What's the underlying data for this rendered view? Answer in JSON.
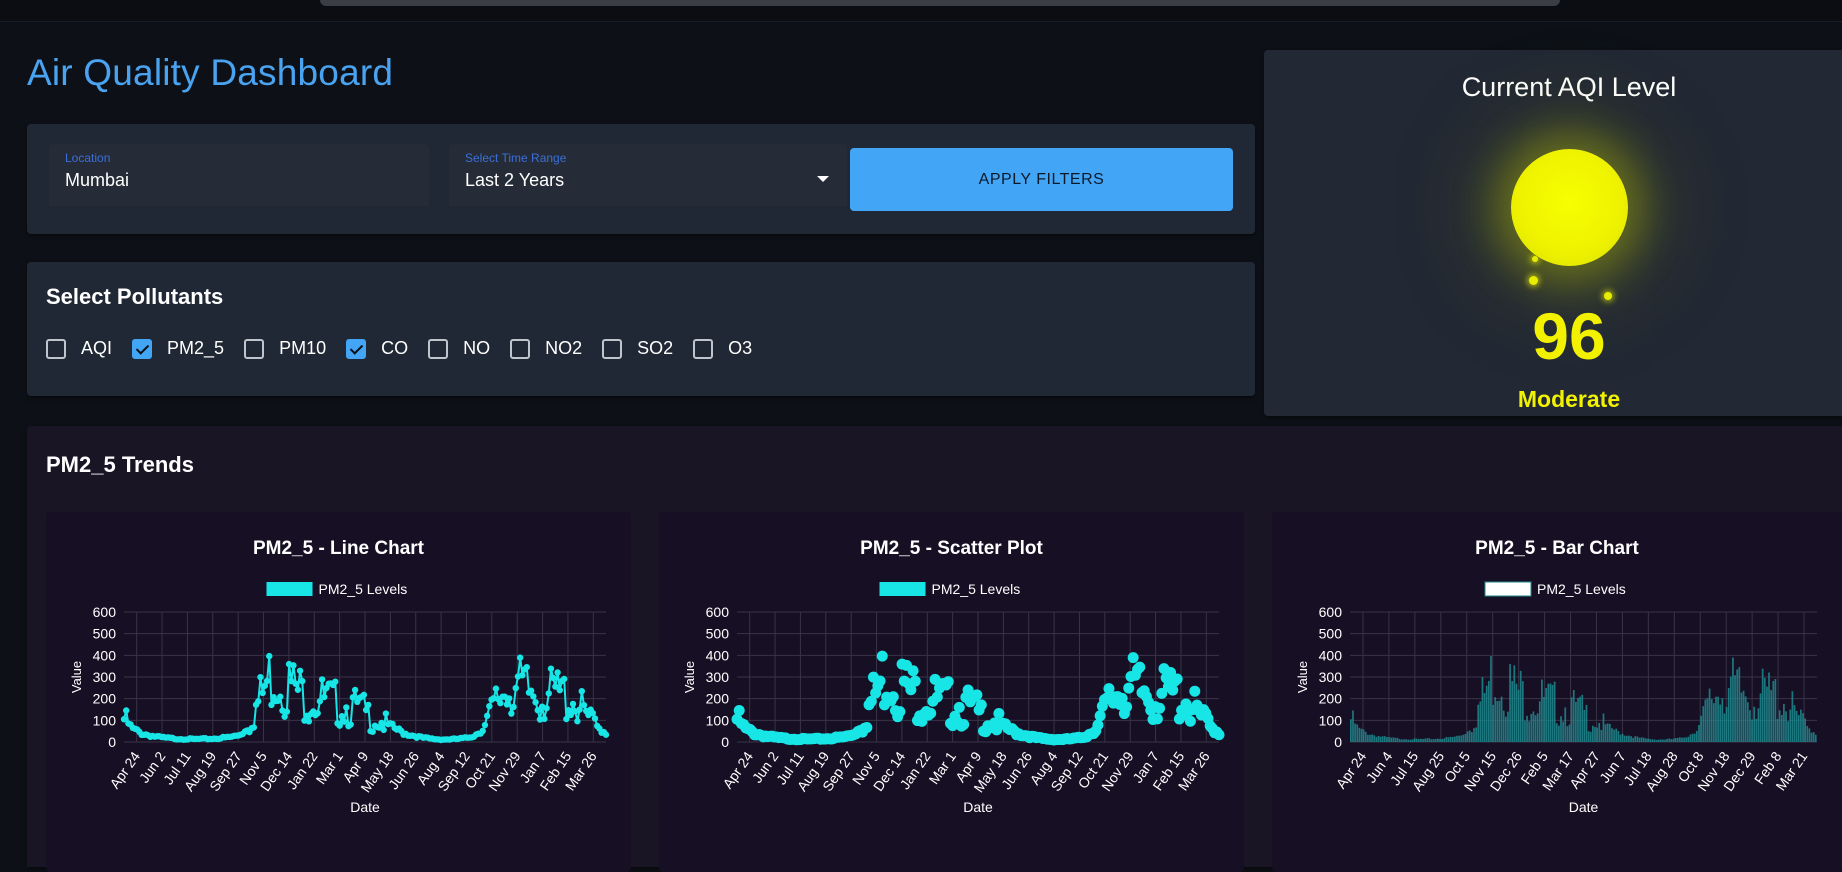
{
  "page_title": "Air Quality Dashboard",
  "filters": {
    "location_label": "Location",
    "location_value": "Mumbai",
    "time_label": "Select Time Range",
    "time_value": "Last 2 Years",
    "apply_label": "APPLY FILTERS"
  },
  "pollutants": {
    "heading": "Select Pollutants",
    "items": [
      {
        "label": "AQI",
        "checked": false
      },
      {
        "label": "PM2_5",
        "checked": true
      },
      {
        "label": "PM10",
        "checked": false
      },
      {
        "label": "CO",
        "checked": true
      },
      {
        "label": "NO",
        "checked": false
      },
      {
        "label": "NO2",
        "checked": false
      },
      {
        "label": "SO2",
        "checked": false
      },
      {
        "label": "O3",
        "checked": false
      }
    ]
  },
  "aqi": {
    "heading": "Current AQI Level",
    "value": "96",
    "category": "Moderate",
    "color": "#f2f200"
  },
  "trends_heading": "PM2_5 Trends",
  "chart_data": [
    {
      "type": "line",
      "title": "PM2_5 - Line Chart",
      "legend": "PM2_5 Levels",
      "xlabel": "Date",
      "ylabel": "Value",
      "ylim": [
        0,
        600
      ],
      "yticks": [
        0,
        100,
        200,
        300,
        400,
        500,
        600
      ],
      "x_ticks": [
        "Apr 24",
        "Jun 2",
        "Jul 11",
        "Aug 19",
        "Sep 27",
        "Nov 5",
        "Dec 14",
        "Jan 22",
        "Mar 1",
        "Apr 9",
        "May 18",
        "Jun 26",
        "Aug 4",
        "Sep 12",
        "Oct 21",
        "Nov 29",
        "Jan 7",
        "Feb 15",
        "Mar 26"
      ],
      "color": "#18e6e6"
    },
    {
      "type": "scatter",
      "title": "PM2_5 - Scatter Plot",
      "legend": "PM2_5 Levels",
      "xlabel": "Date",
      "ylabel": "Value",
      "ylim": [
        0,
        600
      ],
      "yticks": [
        0,
        100,
        200,
        300,
        400,
        500,
        600
      ],
      "x_ticks": [
        "Apr 24",
        "Jun 2",
        "Jul 11",
        "Aug 19",
        "Sep 27",
        "Nov 5",
        "Dec 14",
        "Jan 22",
        "Mar 1",
        "Apr 9",
        "May 18",
        "Jun 26",
        "Aug 4",
        "Sep 12",
        "Oct 21",
        "Nov 29",
        "Jan 7",
        "Feb 15",
        "Mar 26"
      ],
      "color": "#18e6e6"
    },
    {
      "type": "bar",
      "title": "PM2_5 - Bar Chart",
      "legend": "PM2_5 Levels",
      "xlabel": "Date",
      "ylabel": "Value",
      "ylim": [
        0,
        600
      ],
      "yticks": [
        0,
        100,
        200,
        300,
        400,
        500,
        600
      ],
      "x_ticks": [
        "Apr 24",
        "Jun 4",
        "Jul 15",
        "Aug 25",
        "Oct 5",
        "Nov 15",
        "Dec 26",
        "Feb 5",
        "Mar 17",
        "Apr 27",
        "Jun 7",
        "Jul 18",
        "Aug 28",
        "Oct 8",
        "Nov 18",
        "Dec 29",
        "Feb 8",
        "Mar 21"
      ],
      "color": "#1f8a8e"
    }
  ],
  "series_values": [
    105,
    60,
    40,
    30,
    22,
    18,
    15,
    14,
    13,
    14,
    15,
    18,
    22,
    30,
    55,
    150,
    240,
    330,
    290,
    260,
    230,
    210,
    200,
    190,
    180,
    170,
    160,
    150,
    120,
    100,
    80,
    60,
    40,
    30,
    20,
    15,
    12,
    12,
    14,
    18,
    30,
    60,
    140,
    220,
    260,
    250,
    230,
    220,
    210,
    215,
    220,
    200,
    160,
    110,
    70,
    40
  ]
}
